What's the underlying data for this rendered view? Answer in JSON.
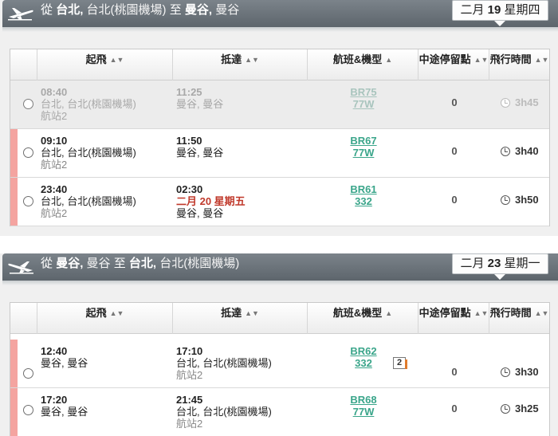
{
  "columns": {
    "departure": "起飛",
    "arrival": "抵達",
    "flight": "航班&機型",
    "stops": "中途停留點",
    "duration": "飛行時間"
  },
  "outbound": {
    "from_label": "從",
    "from_city": "台北,",
    "from_airport": "台北(桃園機場)",
    "to_label": "至",
    "to_city": "曼谷,",
    "to_airport": "曼谷",
    "date_month": "二月",
    "date_day": "19",
    "date_weekday": "星期四",
    "flights": [
      {
        "dep_time": "08:40",
        "dep_city": "台北, 台北(桃園機場)",
        "dep_terminal": "航站2",
        "arr_time": "11:25",
        "arr_date": "",
        "arr_city": "曼谷, 曼谷",
        "flight_no": "BR75",
        "aircraft": "77W",
        "stops": "0",
        "duration": "3h45",
        "available": false
      },
      {
        "dep_time": "09:10",
        "dep_city": "台北, 台北(桃園機場)",
        "dep_terminal": "航站2",
        "arr_time": "11:50",
        "arr_date": "",
        "arr_city": "曼谷, 曼谷",
        "flight_no": "BR67",
        "aircraft": "77W",
        "stops": "0",
        "duration": "3h40",
        "available": true
      },
      {
        "dep_time": "23:40",
        "dep_city": "台北, 台北(桃園機場)",
        "dep_terminal": "航站2",
        "arr_time": "02:30",
        "arr_date": "二月 20 星期五",
        "arr_city": "曼谷, 曼谷",
        "flight_no": "BR61",
        "aircraft": "332",
        "stops": "0",
        "duration": "3h50",
        "available": true
      }
    ]
  },
  "return": {
    "from_label": "從",
    "from_city": "曼谷,",
    "from_airport": "曼谷",
    "to_label": "至",
    "to_city": "台北,",
    "to_airport": "台北(桃園機場)",
    "date_month": "二月",
    "date_day": "23",
    "date_weekday": "星期一",
    "flights": [
      {
        "dep_time": "12:40",
        "dep_city": "曼谷, 曼谷",
        "arr_time": "17:10",
        "arr_city": "台北, 台北(桃園機場)",
        "arr_terminal": "航站2",
        "flight_no": "BR62",
        "aircraft": "332",
        "meal_badge": "2",
        "stops": "0",
        "duration": "3h30"
      },
      {
        "dep_time": "17:20",
        "dep_city": "曼谷, 曼谷",
        "arr_time": "21:45",
        "arr_city": "台北, 台北(桃園機場)",
        "arr_terminal": "航站2",
        "flight_no": "BR68",
        "aircraft": "77W",
        "stops": "0",
        "duration": "3h25"
      }
    ]
  },
  "colors": {
    "header": "#6a7279",
    "selected_flag": "#f4a4a0",
    "flight_link": "#3aa58a",
    "next_day": "#c0392b"
  }
}
